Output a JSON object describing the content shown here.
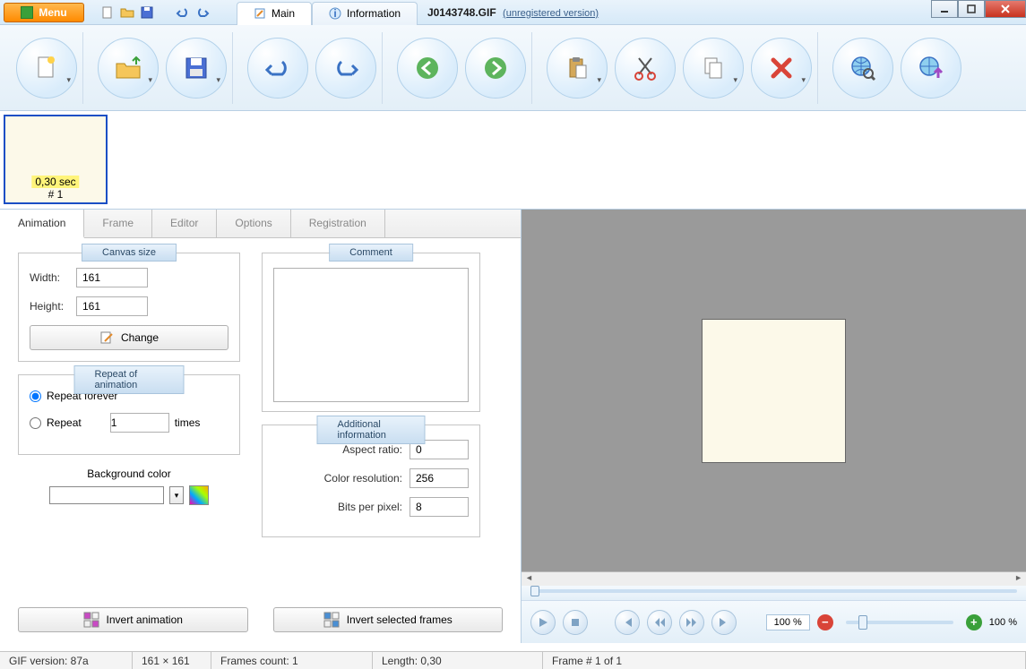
{
  "menu_label": "Menu",
  "tabs_top": {
    "main": "Main",
    "info": "Information"
  },
  "file_name": "J0143748.GIF",
  "unregistered": "(unregistered version)",
  "frame": {
    "duration": "0,30 sec",
    "index": "# 1"
  },
  "left_tabs": [
    "Animation",
    "Frame",
    "Editor",
    "Options",
    "Registration"
  ],
  "canvas": {
    "legend": "Canvas size",
    "width_label": "Width:",
    "width": "161",
    "height_label": "Height:",
    "height": "161",
    "change": "Change"
  },
  "repeat": {
    "legend": "Repeat of animation",
    "forever": "Repeat forever",
    "repeat": "Repeat",
    "count": "1",
    "times": "times"
  },
  "bgcolor_label": "Background color",
  "comment_legend": "Comment",
  "addinfo": {
    "legend": "Additional information",
    "aspect_label": "Aspect ratio:",
    "aspect": "0",
    "color_label": "Color resolution:",
    "color": "256",
    "bits_label": "Bits per pixel:",
    "bits": "8"
  },
  "invert_anim": "Invert animation",
  "invert_sel": "Invert selected frames",
  "zoom": {
    "left": "100 %",
    "right": "100 %"
  },
  "status": {
    "gif": "GIF version: 87a",
    "dims": "161 × 161",
    "frames": "Frames count: 1",
    "length": "Length: 0,30",
    "frame": "Frame # 1 of 1"
  }
}
